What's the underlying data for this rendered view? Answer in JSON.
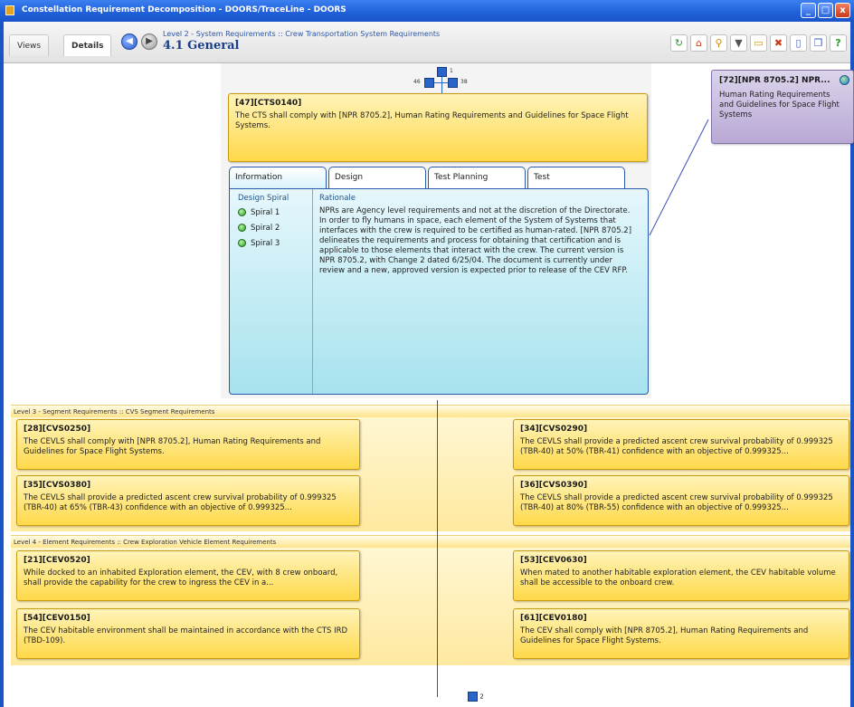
{
  "window": {
    "title": "Constellation Requirement Decomposition - DOORS/TraceLine - DOORS",
    "minimize": "_",
    "maximize": "□",
    "close": "x"
  },
  "toolbar": {
    "views_tab": "Views",
    "details_tab": "Details",
    "back_glyph": "◀",
    "forward_glyph": "▶",
    "breadcrumb": "Level 2 - System Requirements :: Crew Transportation System Requirements",
    "section_title": "4.1 General",
    "icons": [
      "refresh-icon",
      "home-icon",
      "search-icon",
      "filter-icon",
      "folder-icon",
      "export-icon",
      "document-icon",
      "copy-icon",
      "help-icon"
    ],
    "icon_glyphs": [
      "↻",
      "⌂",
      "⚲",
      "▼",
      "▭",
      "✖",
      "▯",
      "❐",
      "?"
    ]
  },
  "mini_nav": {
    "up_count": "1",
    "left_count": "46",
    "right_count": "38"
  },
  "main_requirement": {
    "id": "[47][CTS0140]",
    "text": "The CTS shall comply with [NPR 8705.2], Human Rating Requirements and Guidelines for Space Flight Systems."
  },
  "detail_tabs": [
    "Information",
    "Design",
    "Test Planning",
    "Test"
  ],
  "information": {
    "design_spiral_label": "Design Spiral",
    "spirals": [
      "Spiral 1",
      "Spiral 2",
      "Spiral 3"
    ],
    "rationale_label": "Rationale",
    "rationale_text": "NPRs are Agency level requirements and not at the discretion of the Directorate. In order to fly humans in space, each element of the System of Systems that interfaces with the crew is required to be certified as human-rated. [NPR 8705.2] delineates the requirements and process for obtaining that certification and is applicable to those elements that interact with the crew. The current version is NPR 8705.2, with Change 2 dated 6/25/04. The document is currently under review and a new, approved version is expected prior to release of the CEV RFP."
  },
  "parent_requirement": {
    "id": "[72][NPR 8705.2] NPR...",
    "text": "Human Rating Requirements and Guidelines for Space Flight Systems"
  },
  "level3": {
    "header": "Level 3 - Segment Requirements :: CVS Segment Requirements",
    "items": [
      {
        "id": "[28][CVS0250]",
        "text": "The CEVLS shall comply with [NPR 8705.2], Human Rating Requirements and Guidelines for Space Flight Systems."
      },
      {
        "id": "[34][CVS0290]",
        "text": "The CEVLS shall provide a predicted ascent crew survival probability of 0.999325 (TBR-40) at 50% (TBR-41) confidence with an objective of 0.999325..."
      },
      {
        "id": "[35][CVS0380]",
        "text": "The CEVLS shall provide a predicted ascent crew survival probability of 0.999325 (TBR-40) at 65% (TBR-43) confidence with an objective of 0.999325..."
      },
      {
        "id": "[36][CVS0390]",
        "text": "The CEVLS shall provide a predicted ascent crew survival probability of 0.999325 (TBR-40) at 80% (TBR-55) confidence with an objective of 0.999325..."
      }
    ]
  },
  "level4": {
    "header": "Level 4 - Element Requirements :: Crew Exploration Vehicle Element Requirements",
    "items": [
      {
        "id": "[21][CEV0520]",
        "text": "While docked to an inhabited Exploration element, the CEV, with 8 crew onboard, shall provide the capability for the crew to ingress the CEV in a..."
      },
      {
        "id": "[53][CEV0630]",
        "text": "When mated to another habitable exploration element, the CEV habitable volume shall be accessible to the onboard crew."
      },
      {
        "id": "[54][CEV0150]",
        "text": "The CEV habitable environment shall be maintained in accordance with the CTS IRD (TBD-109)."
      },
      {
        "id": "[61][CEV0180]",
        "text": "The CEV shall comply with [NPR 8705.2], Human Rating Requirements and Guidelines for Space Flight Systems."
      }
    ]
  },
  "bottom_nav": {
    "down_count": "2"
  }
}
